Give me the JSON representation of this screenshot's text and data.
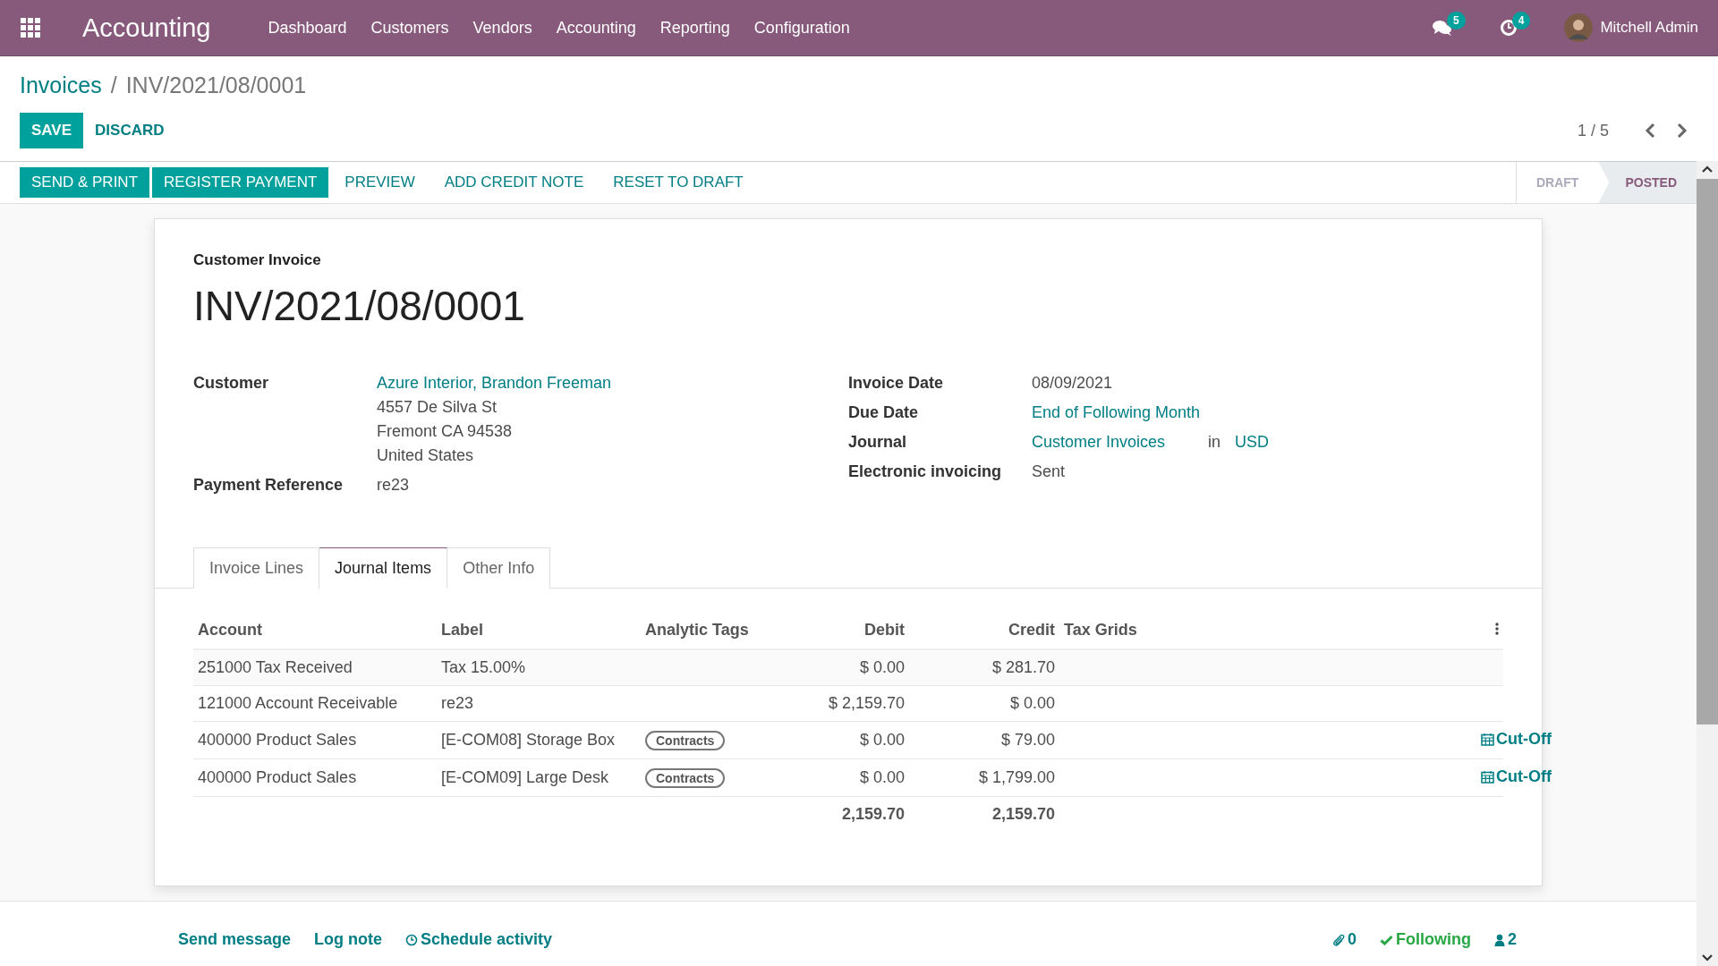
{
  "navbar": {
    "app_name": "Accounting",
    "menu": [
      "Dashboard",
      "Customers",
      "Vendors",
      "Accounting",
      "Reporting",
      "Configuration"
    ],
    "messages_count": "5",
    "activities_count": "4",
    "user": "Mitchell Admin"
  },
  "breadcrumb": {
    "parent": "Invoices",
    "separator": "/",
    "current": "INV/2021/08/0001"
  },
  "control": {
    "save": "SAVE",
    "discard": "DISCARD",
    "pager": "1 / 5"
  },
  "actions": [
    {
      "label": "SEND & PRINT",
      "primary": true
    },
    {
      "label": "REGISTER PAYMENT",
      "primary": true
    },
    {
      "label": "PREVIEW",
      "primary": false
    },
    {
      "label": "ADD CREDIT NOTE",
      "primary": false
    },
    {
      "label": "RESET TO DRAFT",
      "primary": false
    }
  ],
  "statuses": [
    {
      "label": "DRAFT",
      "selected": false
    },
    {
      "label": "POSTED",
      "selected": true
    }
  ],
  "sheet": {
    "type_label": "Customer Invoice",
    "number": "INV/2021/08/0001",
    "left_fields": [
      {
        "label": "Customer",
        "kind": "stack",
        "values": [
          {
            "text": "Azure Interior, Brandon Freeman",
            "link": true
          },
          {
            "text": "4557 De Silva St",
            "link": false
          },
          {
            "text": "Fremont CA 94538",
            "link": false
          },
          {
            "text": "United States",
            "link": false
          }
        ]
      },
      {
        "label": "Payment Reference",
        "kind": "stack",
        "values": [
          {
            "text": "re23",
            "link": false
          }
        ]
      }
    ],
    "right_fields": [
      {
        "label": "Invoice Date",
        "kind": "stack",
        "values": [
          {
            "text": "08/09/2021",
            "link": false
          }
        ]
      },
      {
        "label": "Due Date",
        "kind": "stack",
        "values": [
          {
            "text": "End of Following Month",
            "link": true
          }
        ]
      },
      {
        "label": "Journal",
        "kind": "inline",
        "values": [
          {
            "text": "Customer Invoices",
            "link": true
          },
          {
            "text": "in",
            "link": false
          },
          {
            "text": "USD",
            "link": true
          }
        ]
      },
      {
        "label": "Electronic invoicing",
        "kind": "stack",
        "values": [
          {
            "text": "Sent",
            "link": false
          }
        ]
      }
    ],
    "tabs": [
      {
        "label": "Invoice Lines",
        "selected": false
      },
      {
        "label": "Journal Items",
        "selected": true
      },
      {
        "label": "Other Info",
        "selected": false
      }
    ],
    "table": {
      "columns": [
        "Account",
        "Label",
        "Analytic Tags",
        "Debit",
        "Credit",
        "Tax Grids"
      ],
      "rows": [
        {
          "account": "251000 Tax Received",
          "label": "Tax 15.00%",
          "debit": "$ 0.00",
          "credit": "$ 281.70"
        },
        {
          "account": "121000 Account Receivable",
          "label": "re23",
          "debit": "$ 2,159.70",
          "credit": "$ 0.00"
        },
        {
          "account": "400000 Product Sales",
          "label": "[E-COM08] Storage Box",
          "tag": "Contracts",
          "debit": "$ 0.00",
          "credit": "$ 79.00",
          "action": "Cut-Off"
        },
        {
          "account": "400000 Product Sales",
          "label": "[E-COM09] Large Desk",
          "tag": "Contracts",
          "debit": "$ 0.00",
          "credit": "$ 1,799.00",
          "action": "Cut-Off"
        }
      ],
      "totals": {
        "debit": "2,159.70",
        "credit": "2,159.70"
      }
    }
  },
  "chatter": {
    "actions": [
      {
        "label": "Send message",
        "kind": "plain"
      },
      {
        "label": "Log note",
        "kind": "plain"
      },
      {
        "label": "Schedule activity",
        "kind": "clock"
      }
    ],
    "attachments": "0",
    "follow": "Following",
    "followers": "2"
  }
}
